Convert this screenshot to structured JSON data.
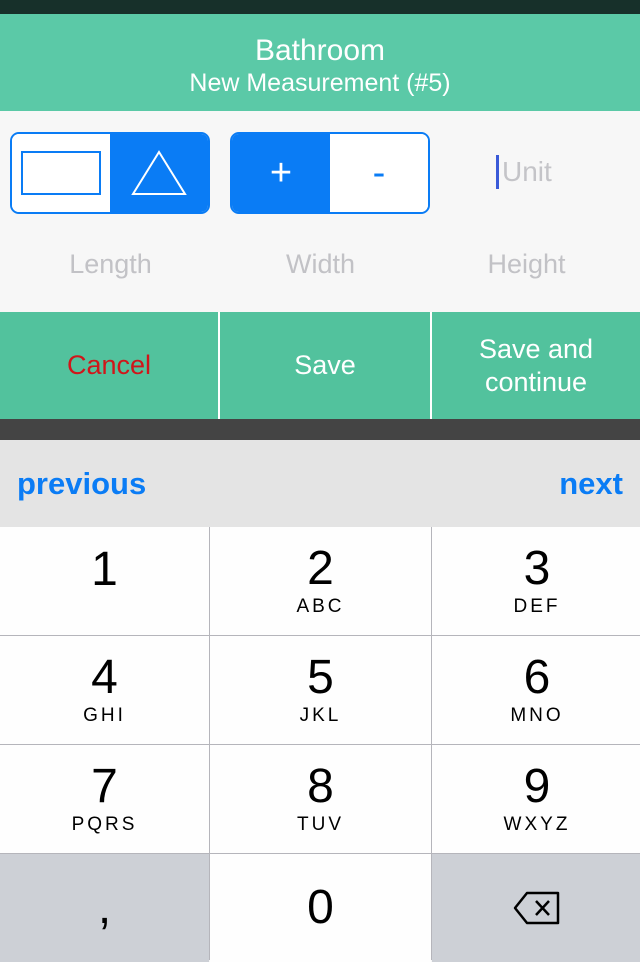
{
  "header": {
    "title": "Bathroom",
    "subtitle": "New Measurement (#5)"
  },
  "shape_toggle": {
    "options": [
      "rectangle",
      "triangle"
    ],
    "selected": "triangle"
  },
  "sign_toggle": {
    "plus": "+",
    "minus": "-",
    "selected": "+"
  },
  "unit_field": {
    "placeholder": "Unit"
  },
  "fields": {
    "length": "Length",
    "width": "Width",
    "height": "Height"
  },
  "actions": {
    "cancel": "Cancel",
    "save": "Save",
    "save_continue": "Save and continue"
  },
  "toolbar": {
    "previous": "previous",
    "next": "next"
  },
  "keypad": [
    {
      "n": "1",
      "l": ""
    },
    {
      "n": "2",
      "l": "ABC"
    },
    {
      "n": "3",
      "l": "DEF"
    },
    {
      "n": "4",
      "l": "GHI"
    },
    {
      "n": "5",
      "l": "JKL"
    },
    {
      "n": "6",
      "l": "MNO"
    },
    {
      "n": "7",
      "l": "PQRS"
    },
    {
      "n": "8",
      "l": "TUV"
    },
    {
      "n": "9",
      "l": "WXYZ"
    },
    {
      "n": ",",
      "l": ""
    },
    {
      "n": "0",
      "l": ""
    },
    {
      "n": "",
      "l": ""
    }
  ],
  "colors": {
    "accent": "#0a7cf5",
    "header": "#5bc9a7",
    "buttons": "#52c29d",
    "cancel": "#d0161a"
  }
}
